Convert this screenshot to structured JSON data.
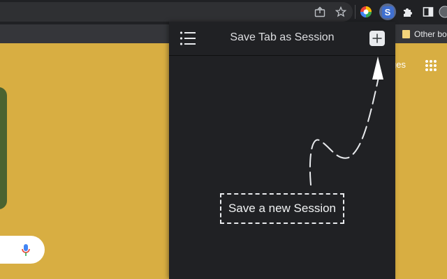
{
  "browser": {
    "toolbar": {
      "icons": [
        "share-icon",
        "star-icon",
        "color-ext-icon",
        "session-ext-icon",
        "puzzle-icon",
        "sidepanel-icon",
        "profile-icon"
      ],
      "session_ext_letter": "S"
    },
    "bookmarks": {
      "other_label": "Other bo"
    }
  },
  "page": {
    "images_label": "ges",
    "background_color": "#d8ae42"
  },
  "popup": {
    "title": "Save Tab as Session",
    "add_button_symbol": "+",
    "hint_label": "Save a new Session",
    "background_color": "#202124"
  }
}
